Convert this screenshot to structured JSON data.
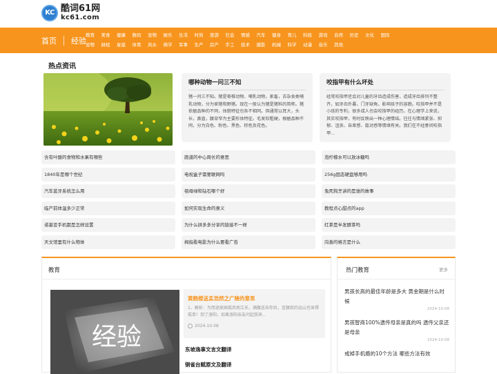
{
  "logo": {
    "mark": "KC",
    "name": "酷词61网",
    "domain": "kc61.com"
  },
  "nav": {
    "home": "首页",
    "experience": "经验",
    "categories": [
      "教育",
      "美食",
      "健康",
      "数码",
      "宠物",
      "娱乐",
      "生活",
      "时尚",
      "旅游",
      "社会",
      "情感",
      "汽车",
      "健身",
      "育儿",
      "科技",
      "游戏",
      "自然",
      "历史",
      "文化",
      "国际",
      "宠物",
      "财经",
      "星座",
      "体育",
      "风水",
      "佛学",
      "军事",
      "生产",
      "房产",
      "手工",
      "技术",
      "摄影",
      "机械",
      "科学",
      "动漫",
      "音乐",
      "其他"
    ]
  },
  "hot": {
    "title": "热点资讯",
    "card1": {
      "title": "哪种动物一问三不知",
      "body": "猪一问三不知。猪是脊椎动物、哺乳动物，家畜，古杂食类哺乳动物，分为家猪和野猪。现在一般认为猪是猪科的简称。猪依据品种的不同，体貌特征也各不相同。但通常以耳大，头长，鼻直，腰背窄为主要形体特征。毛发较粗硬，根据品种不同，分为白色、粉色、黑色、棕色及花色。"
    },
    "card2": {
      "title": "咬指甲有什么坏处",
      "body": "经常咬指甲还会对儿童的牙齿造成伤害，造成牙齿排列不整齐，如牙齿外暴，门牙缺角，影响孩子的容貌。咬指甲并不是小孩的专利，很多成人也会咬指甲的经历。在心理学上来说，其实咬指甲，有时反映出一种心理情结。往往与情绪紧张、抑郁、沮丧、自卑感、敌对感等情绪有关。我们在不经意间咬指甲..."
    },
    "links": [
      [
        "含有叶酸的食物和水果有哪些",
        "跑道的中心周长的意思",
        "泡柠檬水可以放冰糖吗"
      ],
      [
        "1840年是哪个世纪",
        "电视盒子需要联网吗",
        "256g固态硬盘够用吗"
      ],
      [
        "汽车蓝牙系统怎么用",
        "祖母绿和钻石哪个好",
        "兔死狗烹讲的是谁的故事"
      ],
      [
        "临产前体温多少正常",
        "如何实现生命的意义",
        "教程点心甜点的app"
      ],
      [
        "诺基亚手机都是怎样设置",
        "为什么拼多多分享的链接不一样",
        "红茶是半发酵茶吗"
      ],
      [
        "天文馆里有什么物体",
        "拇指看电影为什么要看广告",
        "向善的格言是什么"
      ]
    ]
  },
  "education": {
    "title": "教育",
    "image_text": "经验",
    "feature": {
      "title": "黄鹤楼送孟浩然之广陵的意思",
      "desc": "1、解析：为而迷故国孤风地江天，满腹送去你后，连腰就的远山也显得孤单！到了洛阳，如果洛阳亲友问起我来...",
      "date": "2024-10-08"
    },
    "links": [
      "东坡逸事文言文翻译",
      "铜雀台赋原文及翻译"
    ]
  },
  "hot_sidebar": {
    "title": "热门教育",
    "more": "更多",
    "items": [
      {
        "title": "男孩长高的最佳年龄是多大 黄金期是什么时候",
        "date": "2024-10-08"
      },
      {
        "title": "男孩智商100%遗传母亲是真的吗 遗传父亲还是母亲",
        "date": "2024-10-08"
      },
      {
        "title": "戒掉手机瘾的10个方法 哪些方法有效",
        "date": "2024-10-08"
      }
    ]
  }
}
